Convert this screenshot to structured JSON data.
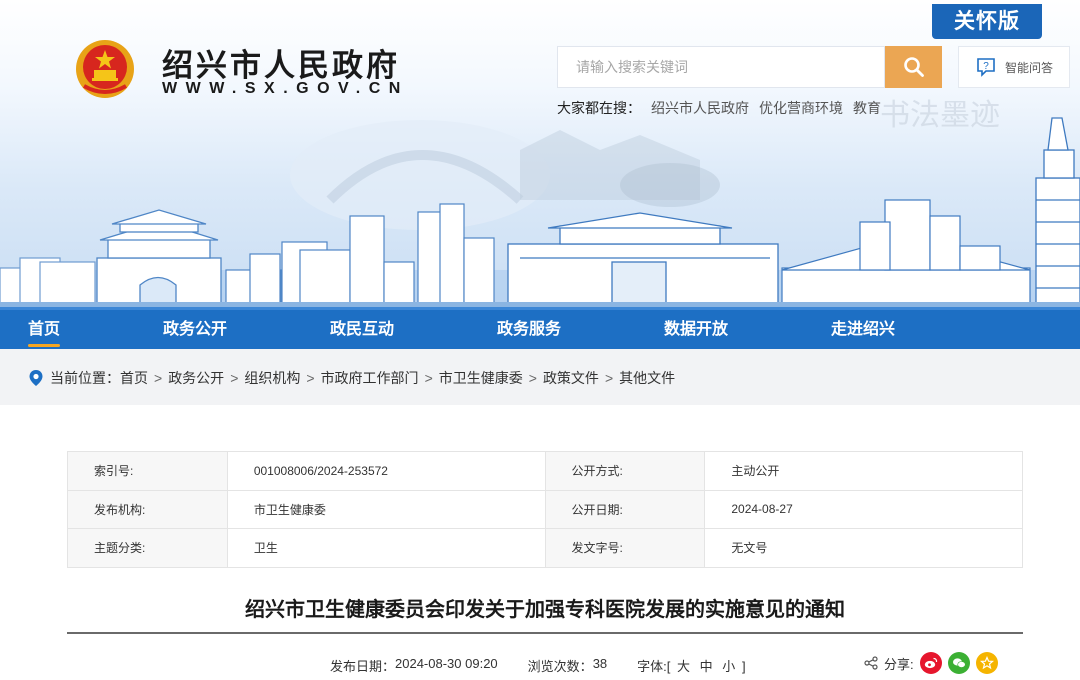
{
  "header": {
    "care_mode": "关怀版",
    "site_name": "绍兴市人民政府",
    "site_url": "WWW.SX.GOV.CN",
    "search": {
      "placeholder": "请输入搜索关键词"
    },
    "qa_label": "智能问答",
    "hot_label": "大家都在搜：",
    "hot_links": [
      "绍兴市人民政府",
      "优化营商环境",
      "教育"
    ],
    "colors": {
      "nav_blue": "#1d6fc4",
      "search_orange": "#eba653",
      "care_blue": "#1b66b8"
    }
  },
  "nav": {
    "items": [
      "首页",
      "政务公开",
      "政民互动",
      "政务服务",
      "数据开放",
      "走进绍兴"
    ],
    "active": "首页"
  },
  "breadcrumb": {
    "prefix": "当前位置：",
    "items": [
      "首页",
      "政务公开",
      "组织机构",
      "市政府工作部门",
      "市卫生健康委",
      "政策文件",
      "其他文件"
    ]
  },
  "info": {
    "rows": [
      {
        "k1": "索引号:",
        "v1": "001008006/2024-253572",
        "k2": "公开方式:",
        "v2": "主动公开"
      },
      {
        "k1": "发布机构:",
        "v1": "市卫生健康委",
        "k2": "公开日期:",
        "v2": "2024-08-27"
      },
      {
        "k1": "主题分类:",
        "v1": "卫生",
        "k2": "发文字号:",
        "v2": "无文号"
      }
    ]
  },
  "article": {
    "title": "绍兴市卫生健康委员会印发关于加强专科医院发展的实施意见的通知",
    "publish_label": "发布日期：",
    "publish_date": "2024-08-30 09:20",
    "views_label": "浏览次数：",
    "views": "38",
    "font_label": "字体:[",
    "font_large": "大",
    "font_medium": "中",
    "font_small": "小",
    "font_close": "]",
    "share_label": "分享:"
  }
}
